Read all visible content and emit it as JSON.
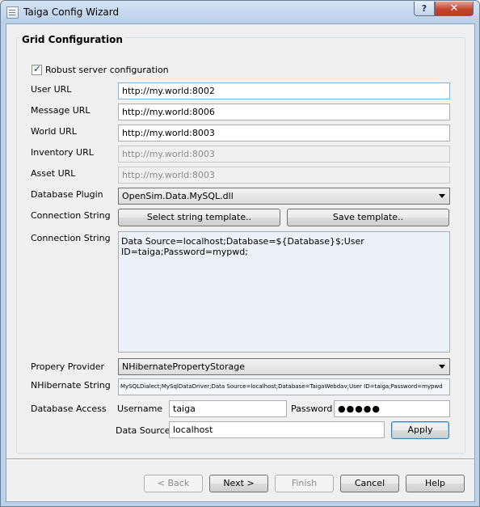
{
  "window": {
    "title": "Taiga Config Wizard",
    "help_glyph": "?",
    "close_glyph": "✕"
  },
  "group": {
    "title": "Grid Configuration"
  },
  "robust": {
    "label": "Robust server configuration",
    "checked": true
  },
  "fields": {
    "user_url_label": "User URL",
    "user_url_value": "http://my.world:8002",
    "message_url_label": "Message URL",
    "message_url_value": "http://my.world:8006",
    "world_url_label": "World URL",
    "world_url_value": "http://my.world:8003",
    "inventory_url_label": "Inventory URL",
    "inventory_url_value": "http://my.world:8003",
    "asset_url_label": "Asset URL",
    "asset_url_value": "http://my.world:8003",
    "database_plugin_label": "Database Plugin",
    "database_plugin_value": "OpenSim.Data.MySQL.dll",
    "connection_string_label": "Connection String",
    "select_template_button": "Select string template..",
    "save_template_button": "Save template..",
    "connection_string_label_2": "Connection String",
    "connection_string_value": "Data Source=localhost;Database=${Database}$;User ID=taiga;Password=mypwd;",
    "property_provider_label": "Propery Provider",
    "property_provider_value": "NHibernatePropertyStorage",
    "nhibernate_string_label": "NHibernate String",
    "nhibernate_string_value": "MySQLDialect;MySqlDataDriver;Data Source=localhost;Database=TaigaWebdav;User ID=taiga;Password=mypwd",
    "database_access_label": "Database Access",
    "username_label": "Username",
    "username_value": "taiga",
    "password_label": "Password",
    "password_value": "●●●●●",
    "data_source_label": "Data Source",
    "data_source_value": "localhost",
    "apply_button": "Apply"
  },
  "footer": {
    "back_button": "< Back",
    "next_button": "Next >",
    "finish_button": "Finish",
    "cancel_button": "Cancel",
    "help_button": "Help"
  },
  "colors": {
    "frame": "#bcd2ea",
    "client": "#f0f0f0",
    "memo_bg": "#ecf1f9",
    "focus_border": "#7eb4ea"
  }
}
